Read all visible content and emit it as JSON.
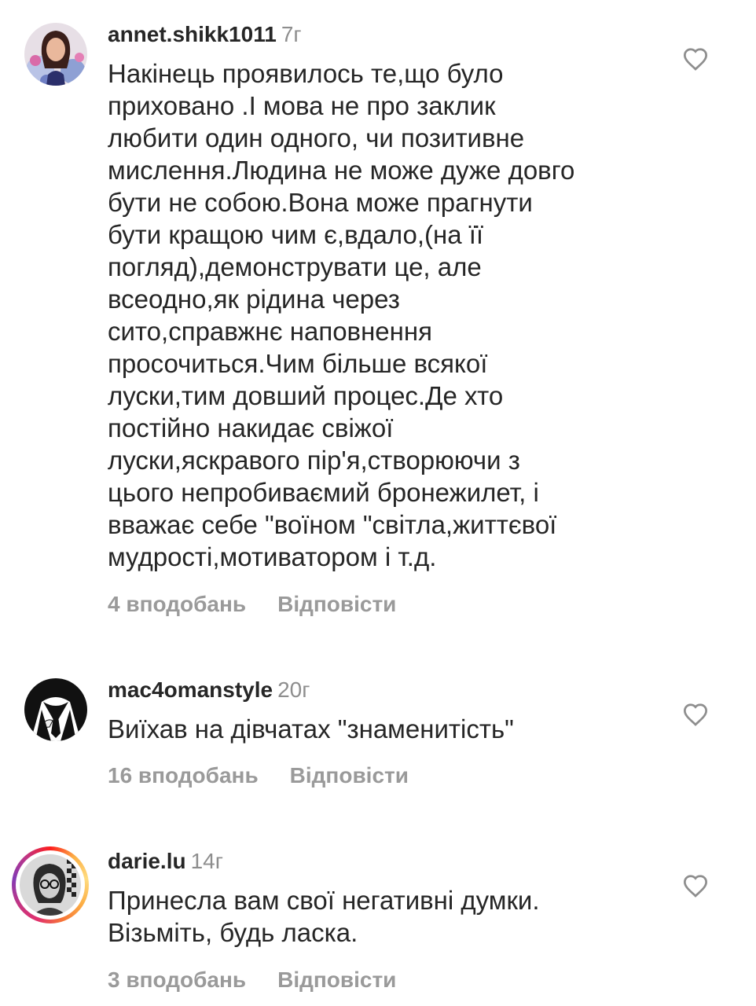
{
  "comments": [
    {
      "username": "annet.shikk1011",
      "time": "7г",
      "text": "Накінець проявилось те,що  було\nприховано .І мова не про заклик\nлюбити один одного, чи позитивне\nмислення.Людина не може дуже довго\nбути не собою.Вона може прагнути\nбути кращою чим є,вдало,(на її\nпогляд),демонструвати це, але\nвсеодно,як рідина через\nсито,справжнє наповнення\nпросочиться.Чим більше всякої\nлуски,тим довший процес.Де хто\nпостійно  накидає  свіжої\nлуски,яскравого пір'я,створюючи з\nцього  непробиваємий бронежилет, і\nвважає себе \"воїном \"світла,життєвої\nмудрості,мотиватором і т.д.",
      "likes": "4 вподобань",
      "reply": "Відповісти",
      "avatar_icon": "user-photo-avatar-icon"
    },
    {
      "username": "mac4omanstyle",
      "time": "20г",
      "text": "Виїхав на дівчатах \"знаменитість\"",
      "likes": "16 вподобань",
      "reply": "Відповісти",
      "avatar_icon": "suit-silhouette-avatar-icon"
    },
    {
      "username": "darie.lu",
      "time": "14г",
      "text": "Принесла вам свої негативні думки.\nВізьміть, будь ласка.",
      "likes": "3 вподобань",
      "reply": "Відповісти",
      "avatar_icon": "story-ring-avatar-icon"
    }
  ],
  "colors": {
    "text": "#262626",
    "secondary": "#8e8e8e",
    "actions": "#9a9a9a",
    "background": "#ffffff"
  },
  "icons": {
    "like": "heart-outline-icon"
  }
}
